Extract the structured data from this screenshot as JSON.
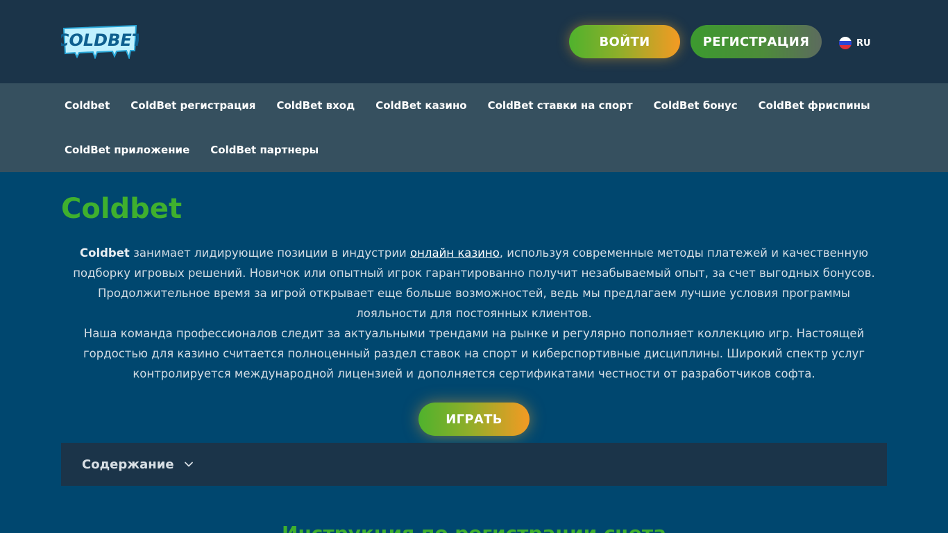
{
  "header": {
    "logo_text": "COLDBET",
    "login_label": "ВОЙТИ",
    "register_label": "РЕГИСТРАЦИЯ",
    "language": "RU",
    "flag_icon": "russia-flag-icon"
  },
  "nav": {
    "row1": [
      "Coldbet",
      "ColdBet регистрация",
      "ColdBet вход",
      "ColdBet казино",
      "ColdBet ставки на спорт",
      "ColdBet бонус",
      "ColdBet фриспины"
    ],
    "row2": [
      "ColdBet приложение",
      "ColdBet партнеры"
    ]
  },
  "main": {
    "title": "Coldbet",
    "p1_bold": "Coldbet",
    "p1_before_link": " занимает лидирующие позиции в индустрии ",
    "p1_link": "онлайн казино",
    "p1_after_link": ", используя современные методы платежей и качественную подборку игровых решений. Новичок или опытный игрок гарантированно получит незабываемый опыт, за счет выгодных бонусов. Продолжительное время за игрой открывает еще больше возможностей, ведь мы предлагаем лучшие условия программы лояльности для постоянных клиентов.",
    "p2": "Наша команда профессионалов следит за актуальными трендами на рынке и регулярно пополняет коллекцию игр. Настоящей гордостью для казино считается полноценный раздел ставок на спорт и киберспортивные дисциплины. Широкий спектр услуг контролируется международной лицензией и дополняется сертификатами честности от разработчиков софта.",
    "play_label": "ИГРАТЬ",
    "toc_label": "Содержание",
    "section_title": "Инструкция по регистрации счета"
  },
  "colors": {
    "background": "#00476f",
    "topbar": "#1b3449",
    "nav": "#36505f",
    "accent_green": "#3fb02e",
    "accent_orange": "#f49a23"
  }
}
